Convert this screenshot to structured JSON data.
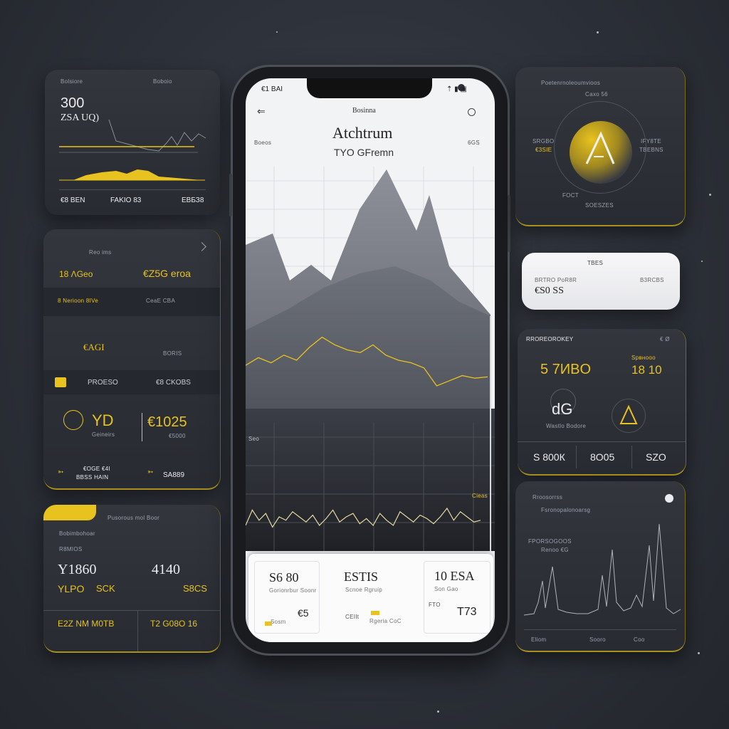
{
  "colors": {
    "accent": "#e8c21e",
    "background": "#2c3038",
    "card": "#30333a",
    "screen": "#f2f3f5"
  },
  "top_left_card": {
    "header_right": "Boboio",
    "header_left": "Bolsiore",
    "value": "300",
    "subtitle": "ZSA UQ)",
    "footer": [
      "€8 BEN",
      "FAKIO 83",
      "ЕВБЗ8"
    ]
  },
  "mid_left_card": {
    "header": "Reo ims",
    "row1_left": "18 ɅGeo",
    "row1_right": "€Z5G eroa",
    "row2_left": "8 Nerioon 8IVe",
    "row2_right": "CeaE CBA",
    "row3_left": "€AGI",
    "row3_right": "BORIS",
    "row4_left": "PROESO",
    "row4_right": "€8 CKOBS",
    "row5_code": "YD",
    "row5_sub": "Geineirs",
    "row5_value": "€1025",
    "row5_value_sub": "€5000",
    "foot_left": "€OGE €4I",
    "foot_left2": "BBSS HAIN",
    "foot_right": "SA889"
  },
  "bottom_left_card": {
    "header": "Pusorous mol Boor",
    "sub1": "Bobimbohoar",
    "sub2": "R8MIOS",
    "value_left": "Y1860",
    "value_right": "4140",
    "gold_left": "YLPO",
    "gold_mid": "SCK",
    "gold_right": "S8CS",
    "foot_left": "E2Z NM M0TB",
    "foot_right": "T2 G08O 16"
  },
  "phone": {
    "status_left": "€1 BAI",
    "header_title": "Bosinna",
    "title": "Atchtrum",
    "subtitle": "TYO GFremn",
    "right_label": "6GS",
    "left_label": "Boeos",
    "middle_label": "Seo",
    "right_small": "Cieas",
    "stats": [
      {
        "value": "S6 80",
        "sub": "Gorionrbur Soonr",
        "foot": "€5",
        "foot_label": "Sosm"
      },
      {
        "value": "ESTIS",
        "sub": "Scnoe Rgruip",
        "foot": "CEIIt",
        "foot_label": "Rgeria CoC"
      },
      {
        "value": "10 ESA",
        "sub": "Son Gao",
        "foot": "T73",
        "foot_label": "FTO"
      }
    ]
  },
  "top_right_card": {
    "header": "Poetenrnoleoumvioos",
    "sub": "Caxo 56",
    "left": "€3SIE",
    "left_top": "SRGBO",
    "right": "TBEBNS",
    "right_top": "IFY8TE",
    "bottom_left": "FOCT",
    "bottom": "SOESZES"
  },
  "white_card": {
    "header": "TBES",
    "left_top": "BRTRO PoR8R",
    "value": "€S0 SS",
    "right_top": "B3RCBS"
  },
  "mid_right_card": {
    "header": "RROREOROKEY",
    "header_right": "€ Ø",
    "value_left": "5 7ИBO",
    "value_right": "18 10",
    "value_right_top": "Ѕрвнооо",
    "logo": "dG",
    "logo_sub": "Wastlo Bodore",
    "foot": [
      "S 800К",
      "8О05",
      "SZO"
    ]
  },
  "bottom_right_card": {
    "header": "Rroosorrss",
    "header2": "Fsronopalonoarsg",
    "label1": "FPORSOGOOS",
    "label2": "Renoo €G",
    "foot": [
      "Eliom",
      "Sooro",
      "Coo"
    ]
  },
  "chart_data": {
    "type": "line",
    "title": "",
    "series": [
      {
        "name": "",
        "values": [
          56,
          62,
          58,
          64,
          60,
          70,
          78,
          72,
          68,
          66,
          72,
          64,
          60,
          58,
          54,
          40,
          44,
          48,
          46,
          47
        ]
      },
      {
        "name": "",
        "values": [
          30,
          48,
          36,
          44,
          28,
          40,
          36,
          46,
          40,
          34,
          42,
          30,
          38,
          48,
          34,
          40,
          44,
          32,
          38,
          30,
          44,
          36,
          30,
          46,
          40,
          34,
          42,
          38,
          32,
          40,
          50,
          36,
          46,
          40,
          34,
          36
        ]
      }
    ]
  }
}
